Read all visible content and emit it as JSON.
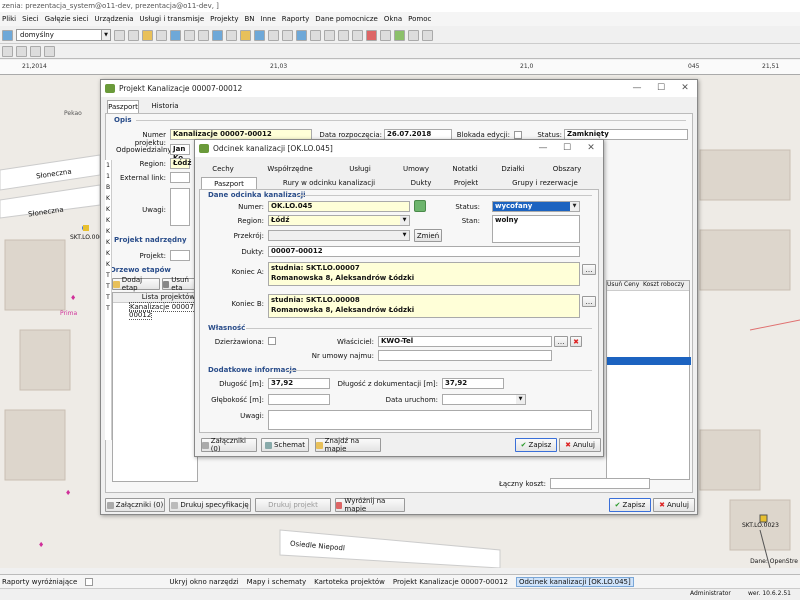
{
  "app": {
    "title": "zenia: prezentacja_system@o11-dev, prezentacja@o11-dev, ]",
    "menu": [
      "Pliki",
      "Sieci",
      "Gałęzie sieci",
      "Urządzenia",
      "Usługi i transmisje",
      "Projekty",
      "BN",
      "Inne",
      "Raporty",
      "Dane pomocnicze",
      "Okna",
      "Pomoc"
    ],
    "toolbar_combo": "domyślny"
  },
  "map": {
    "ruler_labels": [
      "21,2014",
      "21,03",
      "21,0",
      "045",
      "21,51"
    ],
    "labels": [
      "Słoneczna",
      "Słoneczna",
      "Pekao",
      "Prima",
      "Osiedle Niepodl",
      "SKT.LO.00007",
      "SKT.LO.0023"
    ],
    "right_caption": "Dane: OpenStre"
  },
  "project_window": {
    "title": "Projekt Kanalizacje 00007-00012",
    "tabs": [
      "Paszport",
      "Historia statusów"
    ],
    "section_opis": "Opis",
    "numer_label": "Numer projektu:",
    "numer_value": "Kanalizacje 00007-00012",
    "data_label": "Data rozpoczęcia:",
    "data_value": "26.07.2018",
    "blokada_label": "Blokada edycji:",
    "status_label": "Status:",
    "status_value": "Zamknięty",
    "odp_label": "Odpowiedzialny:",
    "odp_value": "Jan Ko",
    "region_label": "Region:",
    "region_value": "Łódź",
    "ext_label": "External link:",
    "uwagi_label": "Uwagi:",
    "section_nadrzedny": "Projekt nadrzędny",
    "projekt_label": "Projekt:",
    "section_drzewo": "Drzewo etapów",
    "dodaj_etap": "Dodaj etap",
    "usun_etap": "Usuń eta",
    "lista_header": "Lista projektów",
    "lista_item": "Kanalizacje 00007-00012",
    "koszt_header": "Koszt roboczy",
    "ceny_header": "Usuń Ceny",
    "laczny": "Łączny koszt:",
    "btn_zalaczniki": "Załączniki (0)",
    "btn_drukuj": "Drukuj specyfikację",
    "btn_drukuj_proj": "Drukuj projekt",
    "btn_wyroznij": "Wyróżnij na mapie",
    "btn_zapisz": "Zapisz",
    "btn_anuluj": "Anuluj",
    "left_rows": [
      "1",
      "1",
      "B",
      "K",
      "K",
      "K",
      "K",
      "K",
      "K",
      "K",
      "T",
      "T",
      "T",
      "T"
    ]
  },
  "odcinek_window": {
    "title": "Odcinek kanalizacji [OK.LO.045]",
    "tabs_row1": [
      "Cechy",
      "Współrzędne",
      "Usługi",
      "Umowy",
      "Notatki",
      "Działki",
      "Obszary"
    ],
    "tabs_row2": [
      "Paszport",
      "Rury w odcinku kanalizacji",
      "Dukty",
      "Projekt",
      "Grupy i rezerwacje"
    ],
    "section_dane": "Dane odcinka kanalizacji",
    "numer_label": "Numer:",
    "numer_value": "OK.LO.045",
    "region_label": "Region:",
    "region_value": "Łódź",
    "przekroj_label": "Przekrój:",
    "zmien": "Zmień",
    "dukty_label": "Dukty:",
    "dukty_value": "00007-00012",
    "status_label": "Status:",
    "status_value": "wycofany",
    "stan_label": "Stan:",
    "stan_value": "wolny",
    "koniec_a_label": "Koniec A:",
    "koniec_a_line1": "studnia: SKT.LO.00007",
    "koniec_a_line2": "Romanowska 8, Aleksandrów Łódzki",
    "koniec_b_label": "Koniec B:",
    "koniec_b_line1": "studnia: SKT.LO.00008",
    "koniec_b_line2": "Romanowska 8, Aleksandrów Łódzki",
    "section_wlasnosc": "Własność",
    "dzierzawiona_label": "Dzierżawiona:",
    "wlasciciel_label": "Właściciel:",
    "wlasciciel_value": "KWO-Tel",
    "nr_umowy_label": "Nr umowy najmu:",
    "section_dodatkowe": "Dodatkowe informacje",
    "dlugosc_label": "Długość [m]:",
    "dlugosc_value": "37,92",
    "dlugosc_dok_label": "Długość z dokumentacji [m]:",
    "dlugosc_dok_value": "37,92",
    "glebokosc_label": "Głębokość [m]:",
    "data_uruch_label": "Data uruchom:",
    "uwagi_label": "Uwagi:",
    "btn_zalaczniki": "Załączniki (0)",
    "btn_schemat": "Schemat",
    "btn_znajdz": "Znajdź na mapie",
    "btn_zapisz": "Zapisz",
    "btn_anuluj": "Anuluj"
  },
  "taskbar": {
    "raporty": "Raporty wyróżniające",
    "items": [
      "Ukryj okno narzędzi",
      "Mapy i schematy",
      "Kartoteka projektów",
      "Projekt Kanalizacje 00007-00012",
      "Odcinek kanalizacji [OK.LO.045]"
    ]
  },
  "statusbar": {
    "user": "Administrator",
    "version": "wer. 10.6.2.51"
  },
  "colors": {
    "accent": "#2a4d8a",
    "highlight_input": "#ffffd8",
    "selected_blue": "#1c63c0"
  }
}
